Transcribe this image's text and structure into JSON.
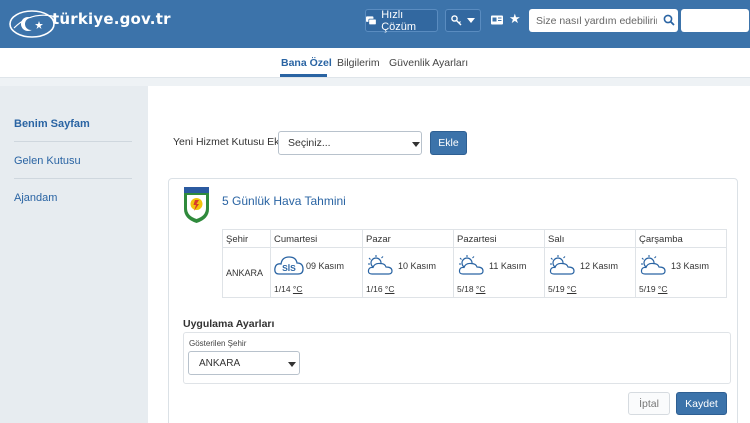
{
  "header": {
    "logo_text": "türkiye.gov.tr",
    "quick_solution": "Hızlı Çözüm",
    "search_placeholder": "Size nasıl yardım edebilirim"
  },
  "nav": {
    "tabs": [
      {
        "label": "Bana Özel",
        "active": true
      },
      {
        "label": "Bilgilerim",
        "active": false
      },
      {
        "label": "Güvenlik Ayarları",
        "active": false
      }
    ]
  },
  "sidebar": {
    "items": [
      {
        "label": "Benim Sayfam",
        "active": true
      },
      {
        "label": "Gelen Kutusu",
        "active": false
      },
      {
        "label": "Ajandam",
        "active": false
      }
    ]
  },
  "service_add": {
    "label": "Yeni Hizmet Kutusu Ekle",
    "select_value": "Seçiniz...",
    "button": "Ekle"
  },
  "weather": {
    "title": "5 Günlük Hava Tahmini",
    "city_header": "Şehir",
    "city": "ANKARA",
    "unit": "°C",
    "days": [
      {
        "day": "Cumartesi",
        "date": "09 Kasım",
        "temp": "1/14",
        "icon": "fog-icon",
        "icon_text": "SİS"
      },
      {
        "day": "Pazar",
        "date": "10 Kasım",
        "temp": "1/16",
        "icon": "partly-cloudy-icon"
      },
      {
        "day": "Pazartesi",
        "date": "11 Kasım",
        "temp": "5/18",
        "icon": "partly-cloudy-icon"
      },
      {
        "day": "Salı",
        "date": "12 Kasım",
        "temp": "5/19",
        "icon": "partly-cloudy-icon"
      },
      {
        "day": "Çarşamba",
        "date": "13 Kasım",
        "temp": "5/19",
        "icon": "partly-cloudy-icon"
      }
    ]
  },
  "settings": {
    "title": "Uygulama Ayarları",
    "city_label": "Gösterilen Şehir",
    "city_value": "ANKARA",
    "cancel": "İptal",
    "save": "Kaydet"
  },
  "colors": {
    "header": "#3c73aa",
    "link": "#2a64a3",
    "sidebar": "#e7ecf0"
  }
}
